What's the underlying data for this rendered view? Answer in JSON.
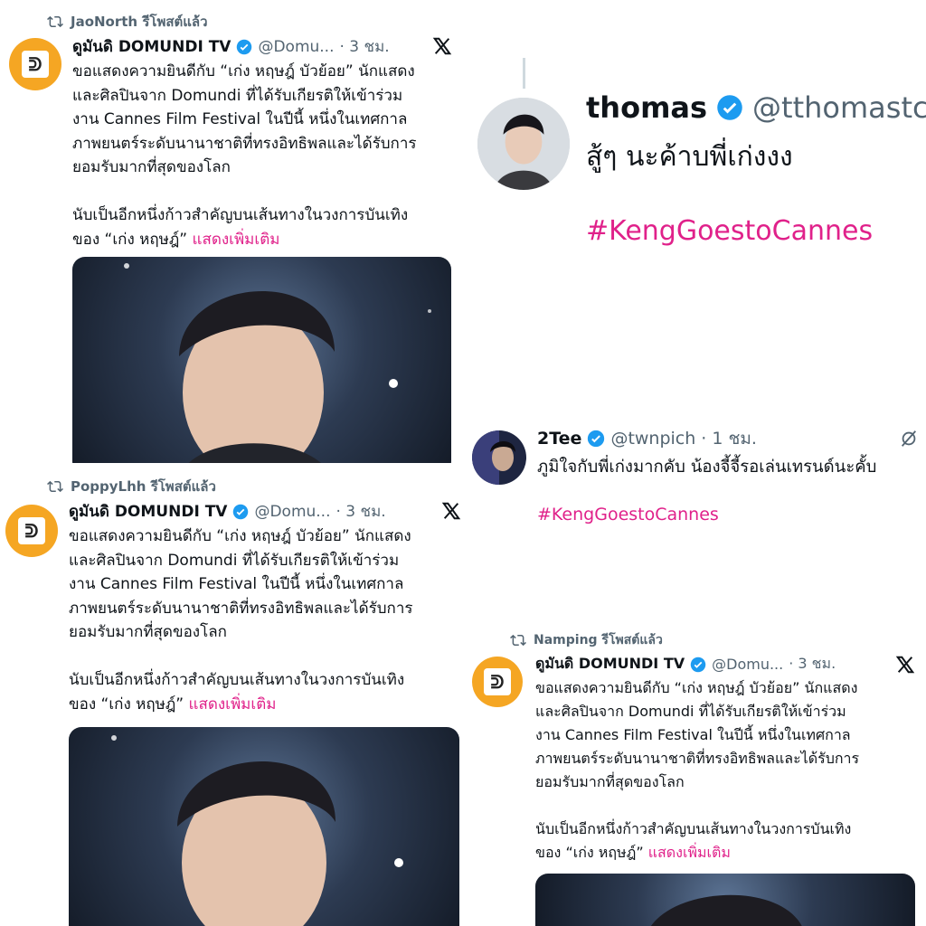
{
  "post_common": {
    "name": "ดูมันดิ DOMUNDI TV",
    "handle": "@Domu...",
    "time": "· 3 ชม.",
    "body": "ขอแสดงความยินดีกับ “เก่ง หฤษฎ์ บัวย้อย” นักแสดง\nและศิลปินจาก Domundi ที่ได้รับเกียรติให้เข้าร่วม\nงาน Cannes Film Festival ในปีนี้ หนึ่งในเทศกาล\nภาพยนตร์ระดับนานาชาติที่ทรงอิทธิพลและได้รับการ\nยอมรับมากที่สุดของโลก\n\nนับเป็นอีกหนึ่งก้าวสำคัญบนเส้นทางในวงการบันเทิง\nของ “เก่ง หฤษฎ์” ",
    "show_more": "แสดงเพิ่มเติม"
  },
  "retweets": {
    "first": "JaoNorth รีโพสต์แล้ว",
    "second": "PoppyLhh รีโพสต์แล้ว",
    "third": "Namping รีโพสต์แล้ว"
  },
  "thomas": {
    "name": "thomas",
    "handle": "@tthomastc ·",
    "text": "สู้ๆ นะค้าบพี่เก่งงง",
    "hashtag": "#KengGoestoCannes"
  },
  "tee": {
    "name": "2Tee",
    "handle": "@twnpich",
    "time": "· 1 ชม.",
    "text": "ภูมิใจกับพี่เก่งมากคับ น้องจี้จี้รอเล่นเทรนด์นะคั้บ",
    "hashtag": "#KengGoestoCannes"
  },
  "colors": {
    "avatar_orange": "#f5a623",
    "verified_blue": "#1d9bf0",
    "hashtag_pink": "#e0218a",
    "muted_gray": "#536471"
  }
}
